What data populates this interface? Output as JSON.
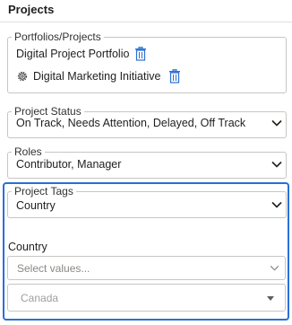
{
  "section": {
    "title": "Projects"
  },
  "portfolios": {
    "legend": "Portfolios/Projects",
    "items": [
      {
        "label": "Digital Project Portfolio",
        "icon": "delete-icon"
      },
      {
        "label": "Digital Marketing Initiative",
        "icon": "delete-icon",
        "prefix_icon": "project-gear-icon"
      }
    ]
  },
  "project_status": {
    "legend": "Project Status",
    "value": "On Track, Needs Attention, Delayed, Off Track"
  },
  "roles": {
    "legend": "Roles",
    "value": "Contributor, Manager"
  },
  "project_tags": {
    "legend": "Project Tags",
    "value": "Country"
  },
  "country_filter": {
    "label": "Country",
    "placeholder": "Select values...",
    "selected": "Canada"
  },
  "colors": {
    "accent": "#2b6fd6",
    "icon_blue": "#2b6fd6",
    "border": "#c8c6c4"
  }
}
